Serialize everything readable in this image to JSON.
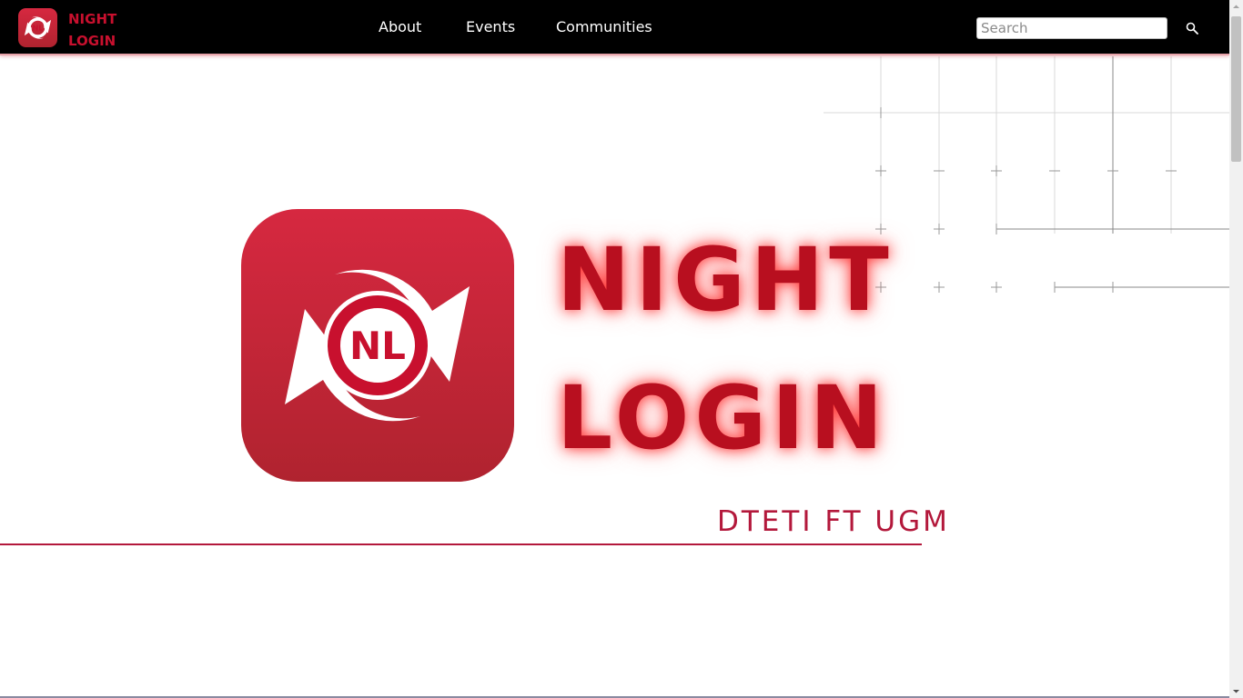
{
  "brand": {
    "line1": "NIGHT",
    "line2": "LOGIN",
    "logo_icon": "nl-logo-icon"
  },
  "nav": {
    "links": [
      {
        "label": "About"
      },
      {
        "label": "Events"
      },
      {
        "label": "Communities"
      }
    ],
    "search_placeholder": "Search",
    "search_icon": "search-icon"
  },
  "hero": {
    "title_line1": "NIGHT",
    "title_line2": "LOGIN",
    "subtitle": "DTETI FT UGM",
    "logo_text": "NL"
  },
  "colors": {
    "navbar_bg": "#000000",
    "brand_red": "#c8102e",
    "title_red": "#b80f1f",
    "subtitle": "#b3183b",
    "logo_gradient_top": "#d62840",
    "logo_gradient_bottom": "#b0232f"
  }
}
